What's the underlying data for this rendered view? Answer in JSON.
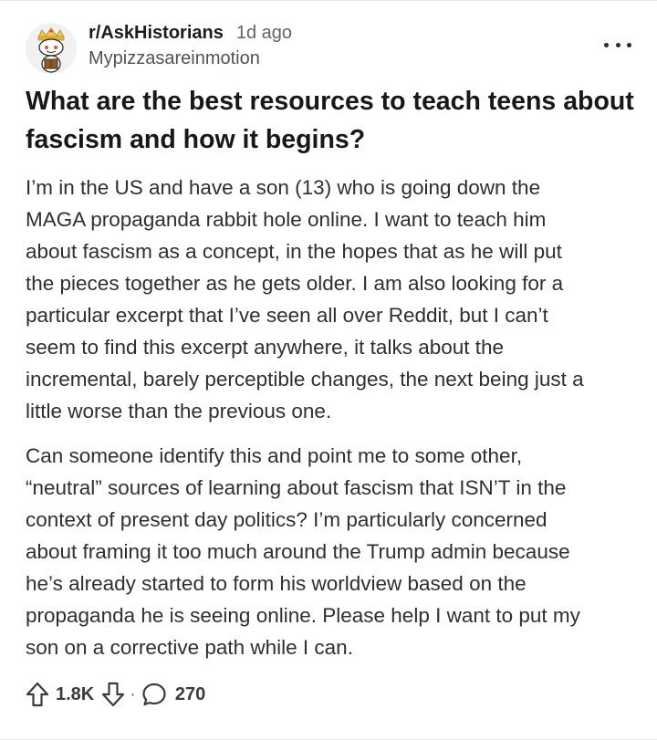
{
  "post": {
    "subreddit": "r/AskHistorians",
    "time_ago": "1d ago",
    "author": "Mypizzasareinmotion",
    "title": "What are the best resources to teach teens about fascism and how it begins?",
    "body": {
      "paragraph1": [
        "I’m in the US and have a son (13) who is going down the",
        "MAGA propaganda rabbit hole online. I want to teach him",
        "about fascism as a concept, in the hopes that as he will put",
        "the pieces together as he gets older. I am also looking for a",
        "particular excerpt that I’ve seen all over Reddit, but I can’t",
        "seem to find this excerpt anywhere, it talks about the",
        "incremental, barely perceptible changes, the next being just a",
        "little worse than the previous one."
      ],
      "paragraph2": [
        "Can someone identify this and point me to some other,",
        "“neutral” sources of learning about fascism that ISN’T in the",
        "context of present day politics? I’m particularly concerned",
        "about framing it too much around the Trump admin because",
        "he’s already started to form his worldview based on the",
        "propaganda he is seeing online. Please help I want to put my",
        "son on a corrective path while I can."
      ]
    },
    "actions": {
      "upvote_count": "1.8K",
      "separator": "·",
      "comment_count": "270"
    }
  },
  "icons": {
    "avatar": "subreddit-avatar-snoo-crowned",
    "more": "more-horizontal-icon",
    "upvote": "upvote-arrow-icon",
    "downvote": "downvote-arrow-icon",
    "comment": "comment-bubble-icon"
  },
  "colors": {
    "text_primary": "#1a1a1b",
    "text_secondary": "#5f6368",
    "crown_gold": "#f2c94c",
    "divider": "#e4e6e8"
  }
}
